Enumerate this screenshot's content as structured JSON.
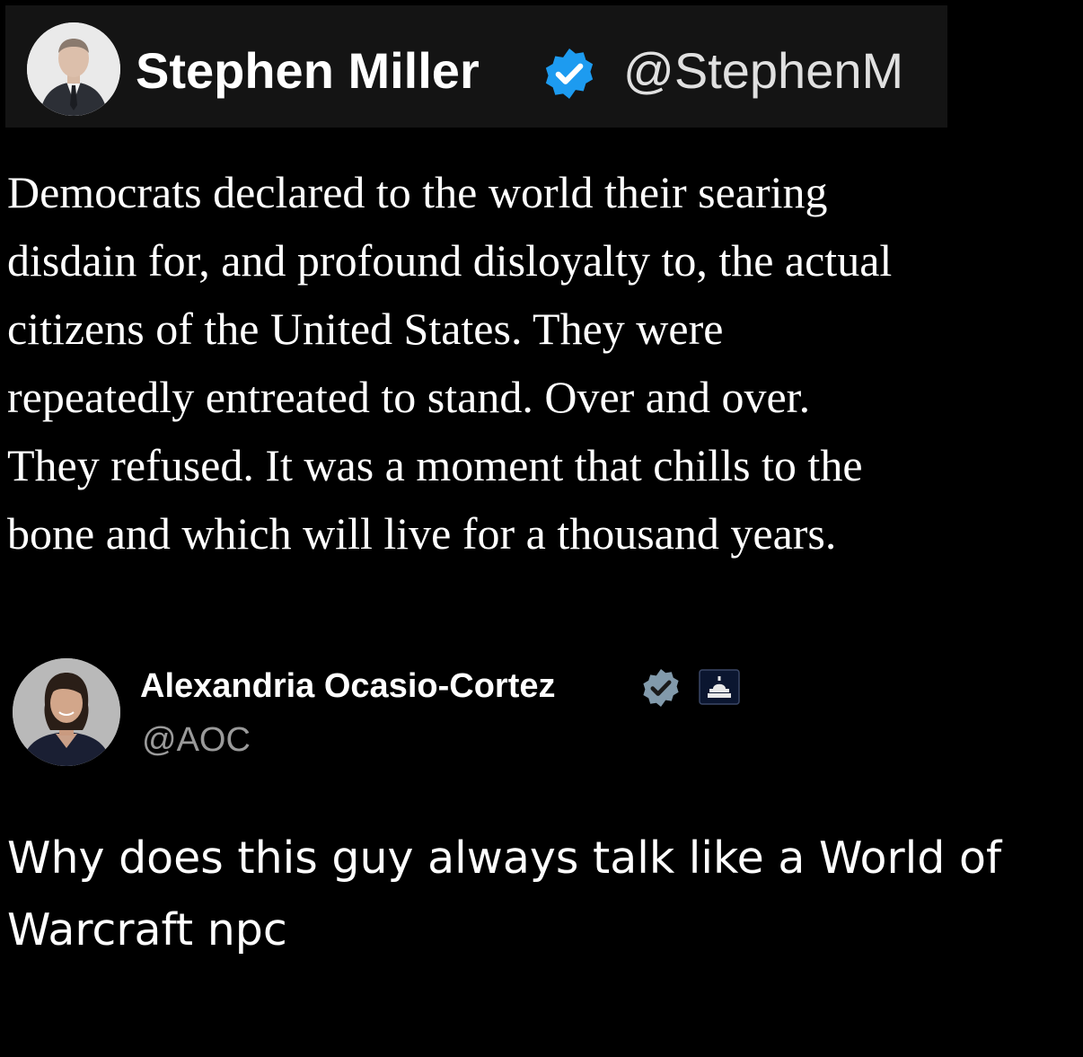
{
  "original_post": {
    "author_name": "Stephen Miller",
    "author_handle": "@StephenM",
    "verified_icon": "verified-check-icon",
    "text": "Democrats declared to the world their searing\ndisdain for, and profound disloyalty to, the actual\ncitizens of the United States. They were\nrepeatedly entreated to stand. Over and over.\nThey refused. It was a moment that chills to the\nbone and which will live for a thousand years."
  },
  "reply": {
    "author_name": "Alexandria Ocasio-Cortez",
    "author_handle": "@AOC",
    "verified_icon": "verified-check-icon",
    "affiliation_icon": "capitol-building-icon",
    "text": "Why does this guy always talk like a World of\nWarcraft npc"
  },
  "colors": {
    "background": "#000000",
    "verified_blue": "#1d9bf0",
    "verified_gray": "#829aab",
    "handle_gray": "#9a9a9a"
  }
}
